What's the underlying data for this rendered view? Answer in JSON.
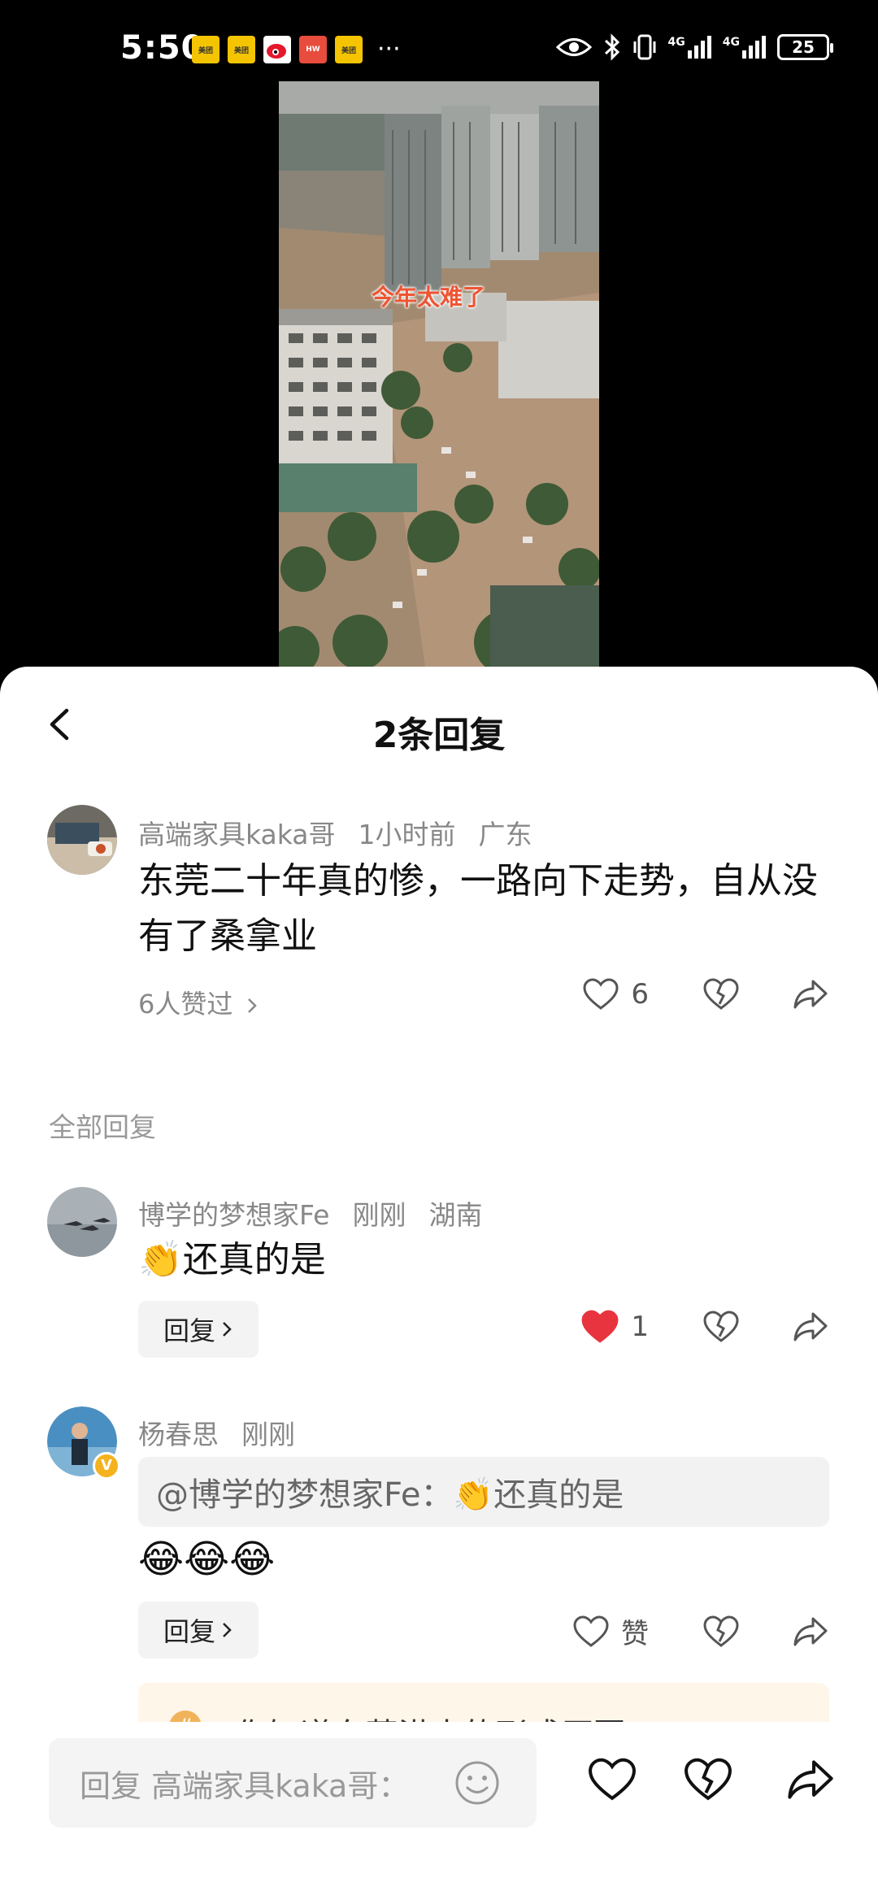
{
  "status_bar": {
    "time": "5:50",
    "battery": "25",
    "network_1": "4G",
    "network_2": "4G",
    "overflow": "···"
  },
  "video": {
    "caption": "今年太难了"
  },
  "sheet": {
    "title": "2条回复"
  },
  "main_comment": {
    "user": "高端家具kaka哥",
    "time": "1小时前",
    "location": "广东",
    "text": "东莞二十年真的惨，一路向下走势，自从没有了桑拿业",
    "likes_link": "6人赞过",
    "like_count": "6"
  },
  "replies_label": "全部回复",
  "replies": [
    {
      "user": "博学的梦想家Fe",
      "time": "刚刚",
      "location": "湖南",
      "text": "👏还真的是",
      "reply_label": "回复",
      "like_count": "1",
      "liked": true
    },
    {
      "user": "杨春思",
      "time": "刚刚",
      "quote": "@博学的梦想家Fe：👏还真的是",
      "emojis": "😂😂😂",
      "reply_label": "回复",
      "like_label": "赞",
      "liked": false
    }
  ],
  "topic_banner": {
    "icon": "#",
    "text": "#你知道东莞洪水的形成原因"
  },
  "bottom_bar": {
    "placeholder": "回复 高端家具kaka哥："
  },
  "colors": {
    "like_red": "#e8343e",
    "muted_text": "#888888",
    "sheet_bg": "#ffffff"
  }
}
